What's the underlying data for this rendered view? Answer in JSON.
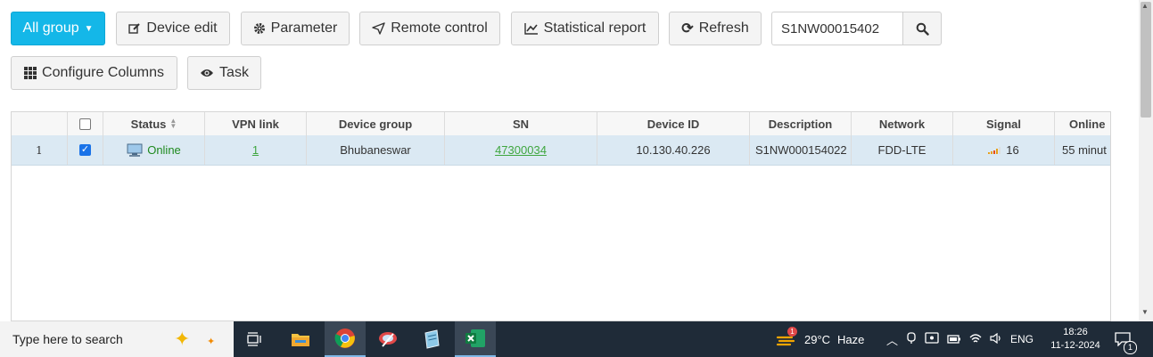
{
  "toolbar": {
    "all_group": "All group",
    "device_edit": "Device edit",
    "parameter": "Parameter",
    "remote_control": "Remote control",
    "statistical_report": "Statistical report",
    "refresh": "Refresh",
    "configure_columns": "Configure Columns",
    "task": "Task"
  },
  "search": {
    "value": "S1NW00015402"
  },
  "table": {
    "columns": [
      "Status",
      "VPN link",
      "Device group",
      "SN",
      "Device ID",
      "Description",
      "Network",
      "Signal",
      "Online"
    ],
    "rows": [
      {
        "index": "1",
        "checked": true,
        "status": "Online",
        "vpn_link": "1",
        "device_group": "Bhubaneswar",
        "sn": "47300034",
        "device_id": "10.130.40.226",
        "description": "S1NW000154022",
        "network": "FDD-LTE",
        "signal": "16",
        "online": "55 minut"
      }
    ]
  },
  "taskbar": {
    "search_placeholder": "Type here to search",
    "weather_temp": "29°C",
    "weather_text": "Haze",
    "weather_badge": "1",
    "language": "ENG",
    "time": "18:26",
    "date": "11-12-2024",
    "notifications": "1"
  },
  "colors": {
    "primary": "#14b7e8",
    "online": "#1f8a1f",
    "link": "#3fa63f",
    "row_selected": "#dbe9f3"
  }
}
